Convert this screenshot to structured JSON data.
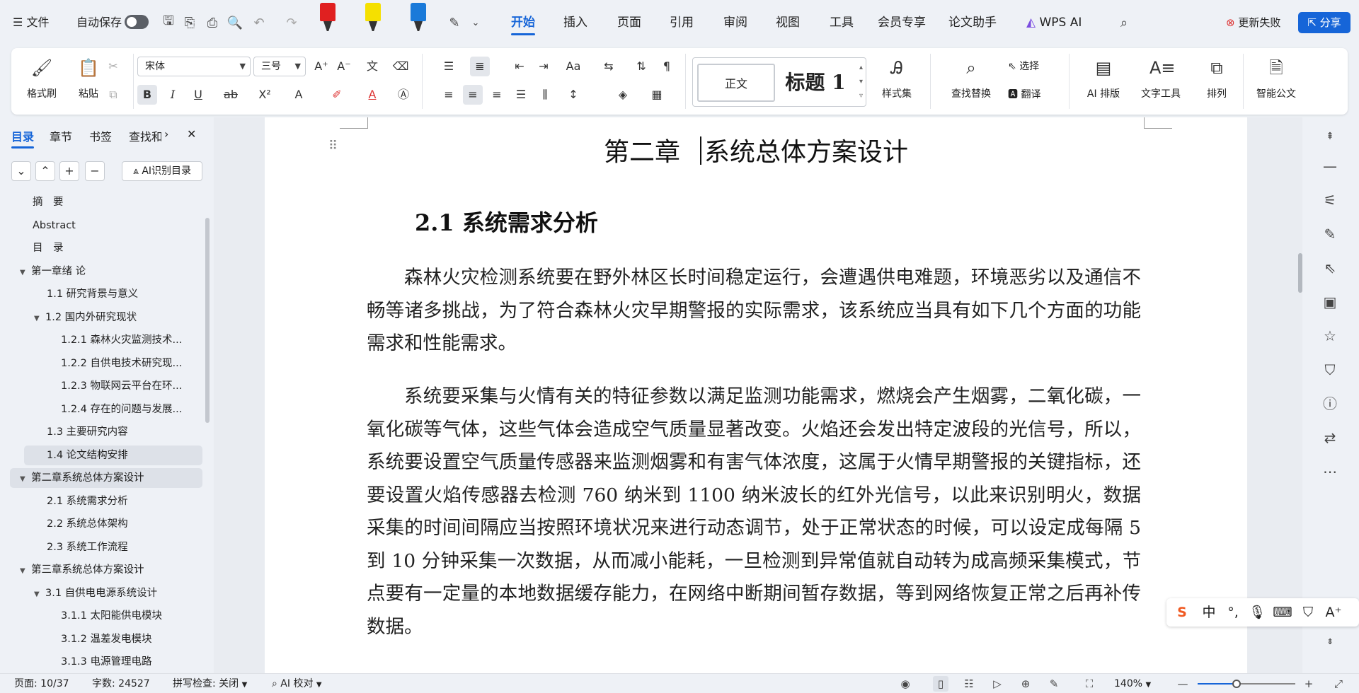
{
  "app": {
    "file_menu": "文件",
    "autosave_label": "自动保存",
    "autosave_on": false,
    "menu_tabs": [
      "开始",
      "插入",
      "页面",
      "引用",
      "审阅",
      "视图",
      "工具",
      "会员专享",
      "论文助手"
    ],
    "active_tab": "开始",
    "wps_ai": "WPS AI",
    "update_failed": "更新失败",
    "share": "分享",
    "accent_color": "#1665d8",
    "marker_colors": [
      "#e02020",
      "#f5e000",
      "#1a7ad9"
    ]
  },
  "ribbon": {
    "format_painter": "格式刷",
    "paste": "粘贴",
    "font_name": "宋体",
    "font_size": "三号",
    "styles": [
      "正文",
      "标题 1"
    ],
    "style_set": "样式集",
    "find_replace": "查找替换",
    "select": "选择",
    "translate": "翻译",
    "ai_layout": "AI 排版",
    "text_tools": "文字工具",
    "arrange": "排列",
    "smart_doc": "智能公文"
  },
  "sidebar": {
    "tabs": [
      "目录",
      "章节",
      "书签",
      "查找和"
    ],
    "active_tab": "目录",
    "ai_toc_button": "AI识别目录",
    "toc": [
      {
        "label": "摘　要",
        "level": 0,
        "caret": ""
      },
      {
        "label": "Abstract",
        "level": 0,
        "caret": ""
      },
      {
        "label": "目　录",
        "level": 0,
        "caret": ""
      },
      {
        "label": "第一章绪 论",
        "level": 0,
        "caret": "▼"
      },
      {
        "label": "1.1 研究背景与意义",
        "level": 1,
        "caret": ""
      },
      {
        "label": "1.2 国内外研究现状",
        "level": 1,
        "caret": "▼"
      },
      {
        "label": "1.2.1 森林火灾监测技术...",
        "level": 2,
        "caret": ""
      },
      {
        "label": "1.2.2 自供电技术研究现...",
        "level": 2,
        "caret": ""
      },
      {
        "label": "1.2.3 物联网云平台在环...",
        "level": 2,
        "caret": ""
      },
      {
        "label": "1.2.4 存在的问题与发展...",
        "level": 2,
        "caret": ""
      },
      {
        "label": "1.3 主要研究内容",
        "level": 1,
        "caret": ""
      },
      {
        "label": "1.4 论文结构安排",
        "level": 1,
        "caret": ""
      },
      {
        "label": "第二章系统总体方案设计",
        "level": 0,
        "caret": "▼"
      },
      {
        "label": "2.1 系统需求分析",
        "level": 1,
        "caret": ""
      },
      {
        "label": "2.2 系统总体架构",
        "level": 1,
        "caret": ""
      },
      {
        "label": "2.3 系统工作流程",
        "level": 1,
        "caret": ""
      },
      {
        "label": "第三章系统总体方案设计",
        "level": 0,
        "caret": "▼"
      },
      {
        "label": "3.1 自供电电源系统设计",
        "level": 1,
        "caret": "▼"
      },
      {
        "label": "3.1.1 太阳能供电模块",
        "level": 2,
        "caret": ""
      },
      {
        "label": "3.1.2 温差发电模块",
        "level": 2,
        "caret": ""
      },
      {
        "label": "3.1.3 电源管理电路",
        "level": 2,
        "caret": ""
      }
    ]
  },
  "document": {
    "chapter_no": "第二章",
    "chapter_title": "系统总体方案设计",
    "section": "2.1  系统需求分析",
    "paragraphs": [
      "森林火灾检测系统要在野外林区长时间稳定运行，会遭遇供电难题，环境恶劣以及通信不畅等诸多挑战，为了符合森林火灾早期警报的实际需求，该系统应当具有如下几个方面的功能需求和性能需求。",
      "系统要采集与火情有关的特征参数以满足监测功能需求，燃烧会产生烟雾，二氧化碳，一氧化碳等气体，这些气体会造成空气质量显著改变。火焰还会发出特定波段的光信号，所以，系统要设置空气质量传感器来监测烟雾和有害气体浓度，这属于火情早期警报的关键指标，还要设置火焰传感器去检测 760 纳米到 1100 纳米波长的红外光信号，以此来识别明火，数据采集的时间间隔应当按照环境状况来进行动态调节，处于正常状态的时候，可以设定成每隔 5 到 10 分钟采集一次数据，从而减小能耗，一旦检测到异常值就自动转为成高频采集模式，节点要有一定量的本地数据缓存能力，在网络中断期间暂存数据，等到网络恢复正常之后再补传数据。"
    ]
  },
  "ime": {
    "mode": "中"
  },
  "status": {
    "page": "页面: 10/37",
    "word_count": "字数: 24527",
    "spell_check": "拼写检查: 关闭",
    "ai_proof": "AI 校对",
    "zoom": "140%",
    "zoom_level": 0.4
  }
}
